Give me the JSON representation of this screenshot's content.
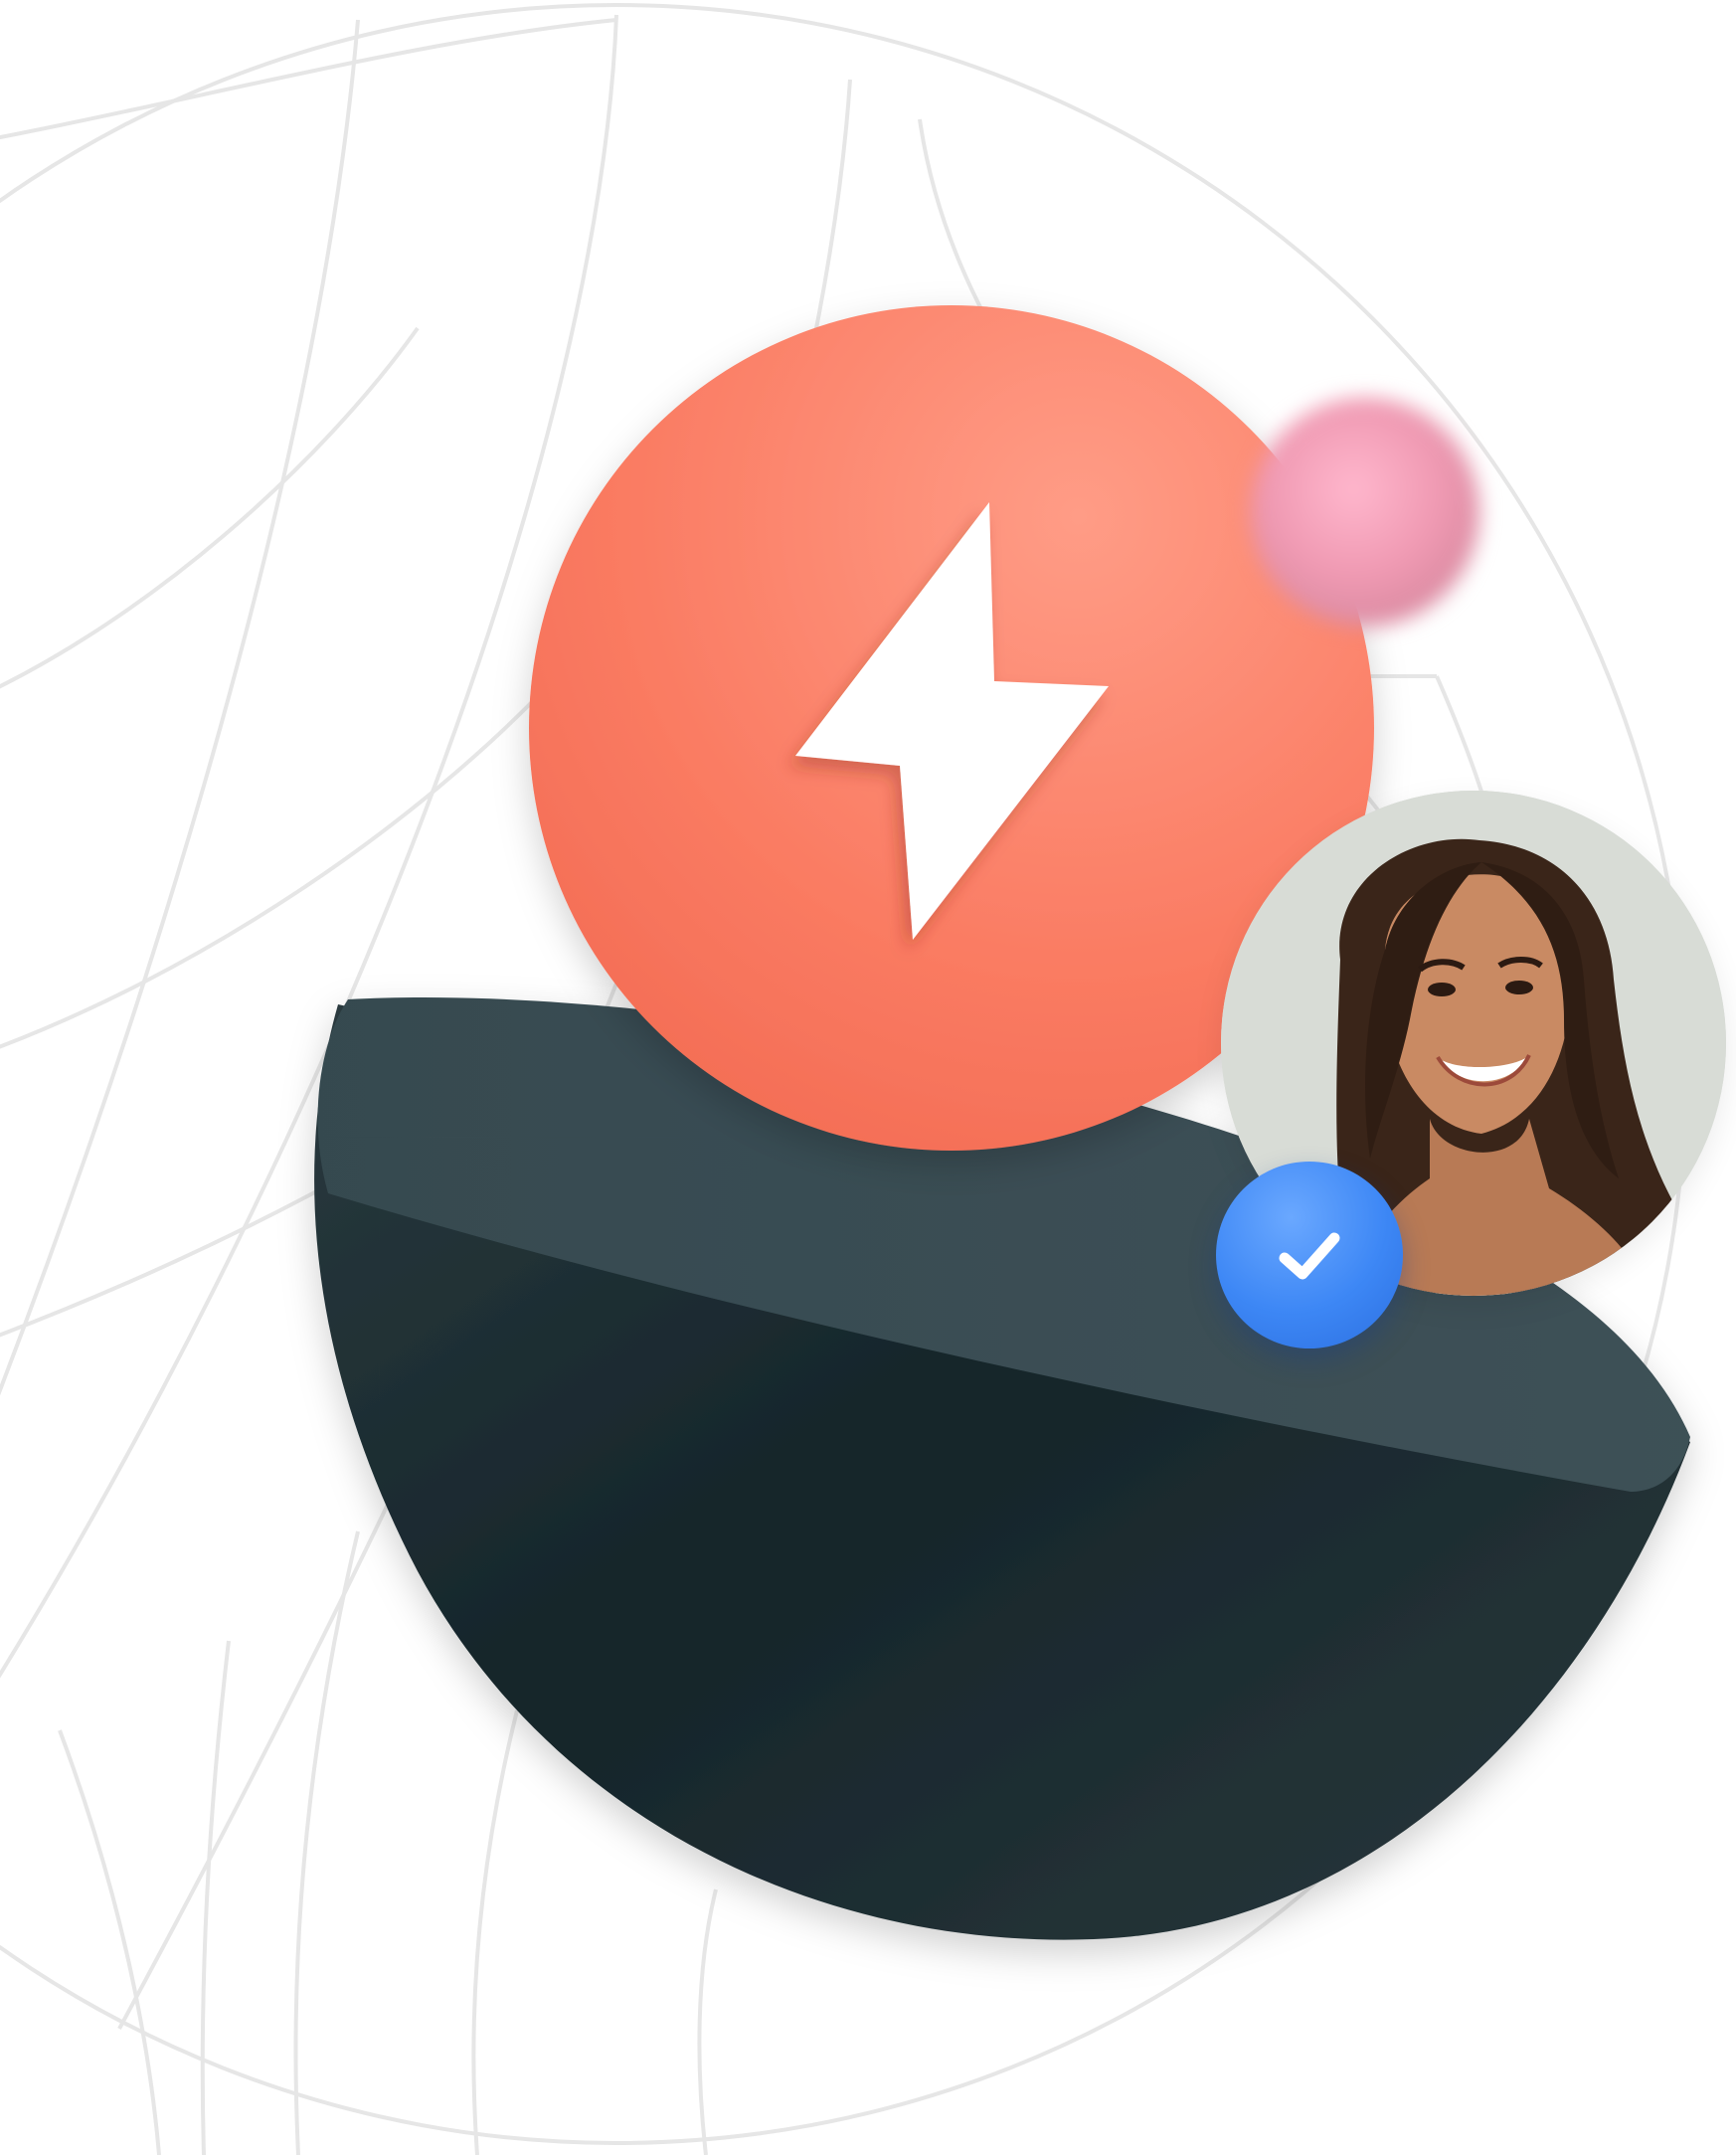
{
  "scene": {
    "background_color": "#ffffff",
    "grid_line_color": "#e6e6e6",
    "lightning_badge_color": "#fa7a61",
    "lightning_icon_color": "#ffffff",
    "bowl_color": "#27363b",
    "blur_ball_color": "#f3a7bd",
    "check_badge_color": "#3d87f5"
  },
  "icons": {
    "lightning": "lightning-bolt-icon",
    "check": "checkmark-icon",
    "avatar": "person-avatar"
  }
}
